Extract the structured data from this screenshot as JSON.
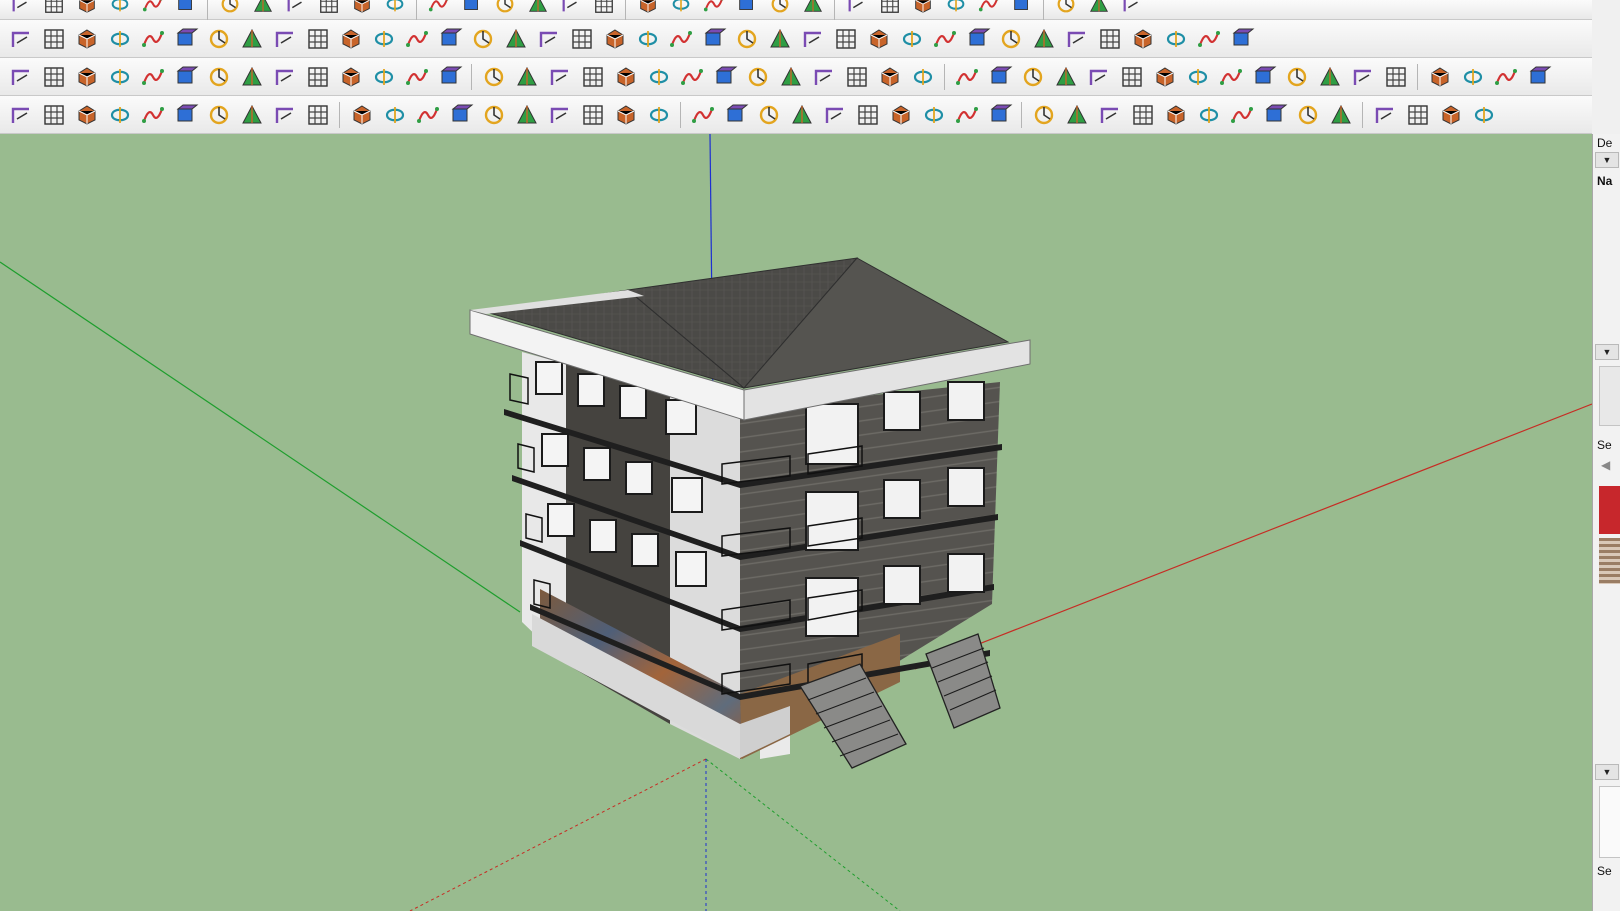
{
  "toolbars": {
    "row0": [
      "eraser-icon",
      "pencil-icon",
      "lasso-icon",
      "paint-bucket-icon",
      "book-icon",
      "undo-icon",
      "push-pull-icon",
      "rotate-icon",
      "clipboard-icon",
      "measure-icon",
      "dimension-icon",
      "tag-icon",
      "redo-icon",
      "flag-icon",
      "zoom-icon",
      "zoom-extents-icon",
      "orbit-icon",
      "waves-icon",
      "layers-icon",
      "settings-icon",
      "globe-check-icon",
      "camera-icon",
      "scene-icon",
      "stack-icon",
      "stack-icon",
      "stack-icon",
      "stack-icon",
      "plugin-icon",
      "plugin-icon",
      "plugin-icon",
      "play-icon",
      "record-icon",
      "earth-icon"
    ],
    "row1": [
      "spline-icon",
      "paint-bucket-icon",
      "scissors-icon",
      "gear-shape-icon",
      "box-outline-icon",
      "curve-icon",
      "box-3d-icon",
      "globe-wire-icon",
      "arrow-curve-icon",
      "corner-icon",
      "corner-icon",
      "angle-icon",
      "sweep-icon",
      "arch-icon",
      "prism-icon",
      "pillars-icon",
      "grid-icon",
      "hand-icon",
      "page-fold-icon",
      "chevron-left-icon",
      "stairs-icon",
      "slope-icon",
      "zigzag-icon",
      "split-icon",
      "split-icon",
      "helmet-icon",
      "stripes-icon",
      "panel-icon",
      "curve-surface-icon",
      "fence-icon",
      "tiles-icon",
      "layers-icon",
      "columns-icon",
      "mesh-icon",
      "shell-icon",
      "diagonal-icon",
      "diagonal-icon",
      "house-outline-icon"
    ],
    "row2": [
      "plane-blue-icon",
      "plane-yellow-icon",
      "plane-green-icon",
      "plane-red-icon",
      "plane-outline-icon",
      "ring-icon",
      "red-box-icon",
      "lines-icon",
      "flag-outline-icon",
      "box-brown-icon",
      "wrench-icon",
      "hook-icon",
      "points-icon",
      "cross-red-icon",
      "cross-green-icon",
      "cross-blue-icon",
      "cone-icon",
      "cone-icon",
      "triangle-icon",
      "ring-icon",
      "ring-icon",
      "knot-icon",
      "move-icon",
      "cylinder-icon",
      "undo-icon",
      "leaf-icon",
      "box-3d-icon",
      "box-red-icon",
      "box-red-icon",
      "sphere-icon",
      "gear-shape-icon",
      "frame-icon",
      "tile-orange-icon",
      "tile-orange-icon",
      "tile-orange-icon",
      "scatter-icon",
      "dots-circle-icon",
      "grid-icon",
      "pen-line-icon",
      "tripod-icon",
      "paint-bucket-icon",
      "pyramid-icon",
      "shapes-icon",
      "shapes-icon",
      "curve-surface-icon",
      "scale-icon"
    ],
    "row3": [
      "lock-icon",
      "leaf-icon",
      "arc-icon",
      "curve-icon",
      "curve-icon",
      "curve-icon",
      "curve-icon",
      "arc-icon",
      "square-icon",
      "spiral-icon",
      "arc-icon",
      "curve-icon",
      "arc-icon",
      "arc-icon",
      "arc-icon",
      "curve-icon",
      "circle-icon",
      "wrench-icon",
      "circle-icon",
      "arc-icon",
      "book-icon",
      "house-green-icon",
      "select-arrow-icon",
      "scale-box-icon",
      "scale-box-icon",
      "align-icon",
      "align-icon",
      "align-icon",
      "align-icon",
      "align-icon",
      "align-icon",
      "grid-cross-icon",
      "grid-cross-icon",
      "grid-cross-icon",
      "grid-icon",
      "grid-icon",
      "grid-cross-icon",
      "tiles-icon",
      "tiles-icon",
      "helmet-icon",
      "checker-icon",
      "copy-icon",
      "copy-icon",
      "network-icon"
    ]
  },
  "tray": {
    "labels": [
      "De",
      "Na",
      "Se",
      "Se"
    ],
    "swatch_color": "#c7272c"
  },
  "scene": {
    "sky_color": "#99bb8f",
    "axis_colors": {
      "blue": "#1d2fd2",
      "green": "#1e9e2d",
      "red": "#c62c24"
    }
  }
}
